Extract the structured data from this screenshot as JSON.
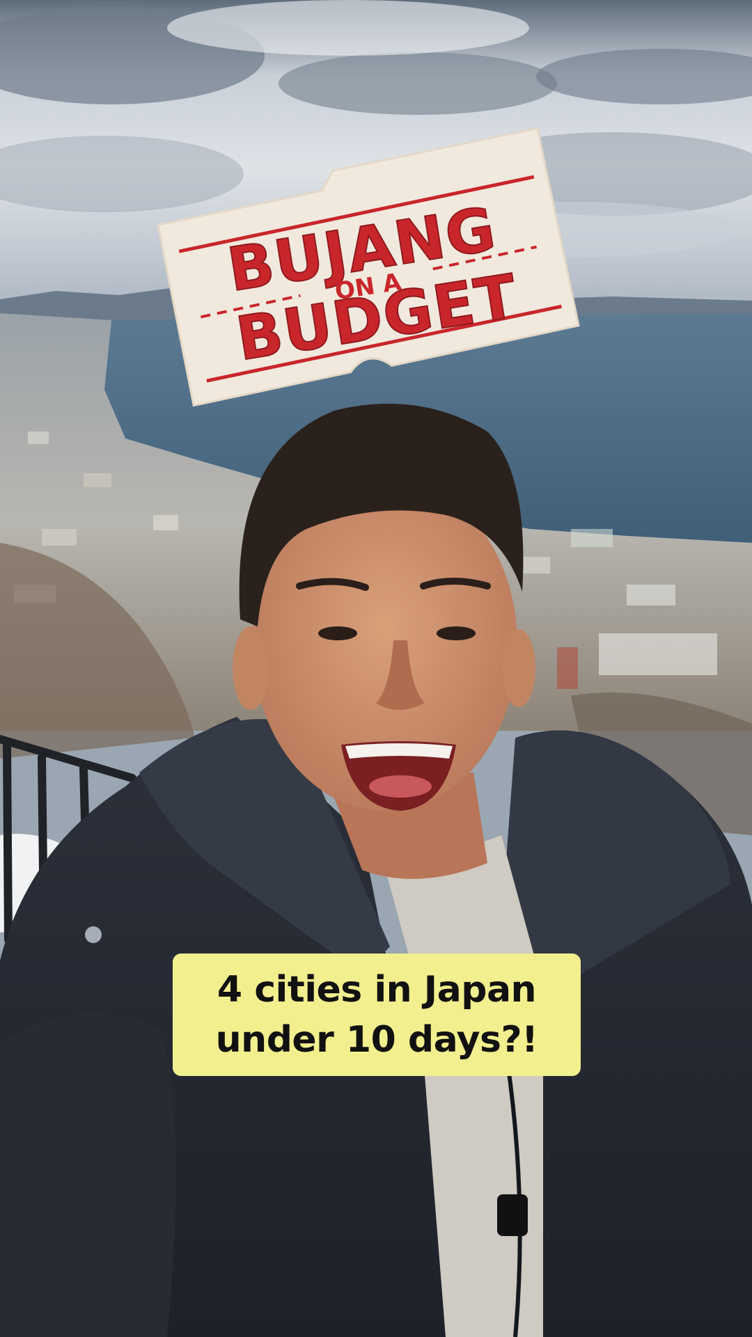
{
  "video": {
    "logo": {
      "line1": "BUJANG",
      "line2": "ON A",
      "line3": "BUDGET"
    },
    "caption": {
      "line1": "4 cities in Japan",
      "line2": "under 10 days?!"
    }
  },
  "colors": {
    "caption_background": "#f2ef8e",
    "caption_text": "#111111",
    "logo_paper": "#f1e9de",
    "logo_red": "#c9262b"
  },
  "icons": {
    "logo": "bujang-on-a-budget-logo-icon"
  }
}
